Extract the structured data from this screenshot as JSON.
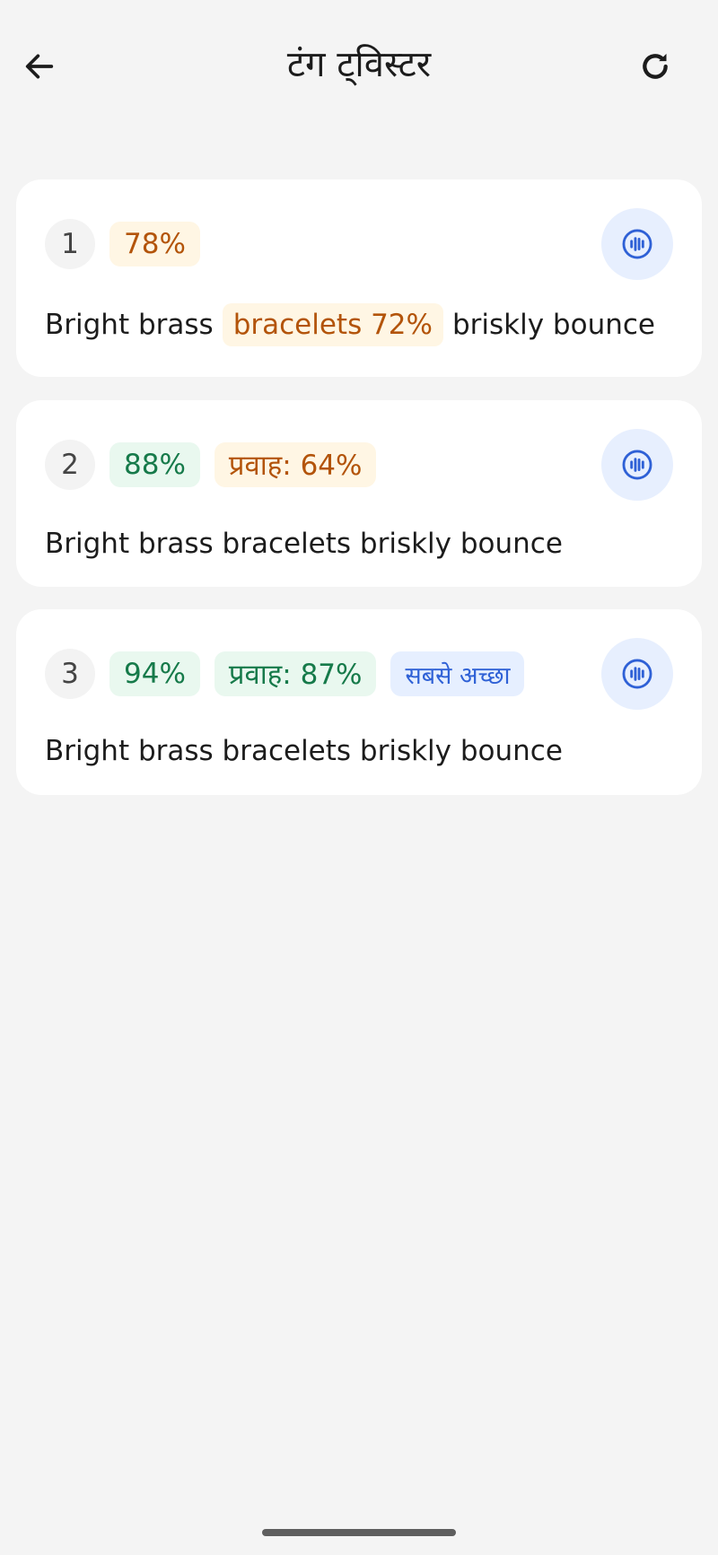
{
  "header": {
    "title": "टंग ट्विस्टर",
    "back_icon": "arrow-left-icon",
    "refresh_icon": "refresh-icon"
  },
  "attempts": [
    {
      "number": "1",
      "score": "78%",
      "sentence_pre": "Bright brass",
      "highlight": "bracelets 72%",
      "sentence_post": "briskly bounce",
      "audio_icon": "audio-play-icon"
    },
    {
      "number": "2",
      "score": "88%",
      "fluency": "प्रवाह: 64%",
      "sentence": "Bright brass bracelets briskly bounce",
      "audio_icon": "audio-play-icon"
    },
    {
      "number": "3",
      "score": "94%",
      "fluency": "प्रवाह: 87%",
      "best_label": "सबसे अच्छा",
      "sentence": "Bright brass bracelets briskly bounce",
      "audio_icon": "audio-play-icon"
    }
  ],
  "colors": {
    "background": "#f4f4f4",
    "card": "#ffffff",
    "orange_text": "#b3540a",
    "orange_bg": "#fff6e4",
    "green_text": "#167a4a",
    "green_bg": "#e9f8ef",
    "blue_text": "#2f61d6",
    "blue_bg": "#e6efff"
  }
}
